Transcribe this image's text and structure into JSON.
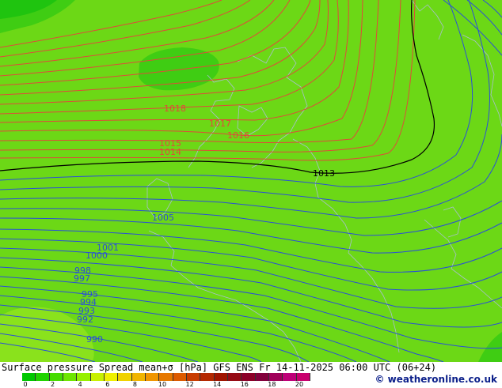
{
  "map": {
    "isobar_labels": [
      {
        "text": "1018",
        "color": "#e04a3a"
      },
      {
        "text": "1017",
        "color": "#e04a3a"
      },
      {
        "text": "1016",
        "color": "#e04a3a"
      },
      {
        "text": "1015",
        "color": "#e04a3a"
      },
      {
        "text": "1014",
        "color": "#e04a3a"
      },
      {
        "text": "1013",
        "color": "#000000"
      },
      {
        "text": "1005",
        "color": "#2a4fd8"
      },
      {
        "text": "1001",
        "color": "#2a4fd8"
      },
      {
        "text": "1000",
        "color": "#2a4fd8"
      },
      {
        "text": "998",
        "color": "#2a4fd8"
      },
      {
        "text": "997",
        "color": "#2a4fd8"
      },
      {
        "text": "995",
        "color": "#2a4fd8"
      },
      {
        "text": "994",
        "color": "#2a4fd8"
      },
      {
        "text": "993",
        "color": "#2a4fd8"
      },
      {
        "text": "992",
        "color": "#2a4fd8"
      },
      {
        "text": "990",
        "color": "#2a4fd8"
      }
    ]
  },
  "footer": {
    "title": "Surface pressure Spread mean+σ [hPa] GFS ENS  Fr 14-11-2025 06:00 UTC (06+24)",
    "credit": "© weatheronline.co.uk",
    "colorbar_ticks": [
      "0",
      "2",
      "4",
      "6",
      "8",
      "10",
      "12",
      "14",
      "16",
      "18",
      "20"
    ],
    "colorbar_colors": [
      "#00c800",
      "#20d200",
      "#46dc00",
      "#6ee600",
      "#96f000",
      "#c8f000",
      "#f0f000",
      "#f0d200",
      "#f0b400",
      "#f09600",
      "#e67800",
      "#dc5a00",
      "#c83c00",
      "#b42800",
      "#a01400",
      "#960a14",
      "#8c0028",
      "#82003c",
      "#a0005a",
      "#be0078",
      "#c8006e"
    ]
  }
}
